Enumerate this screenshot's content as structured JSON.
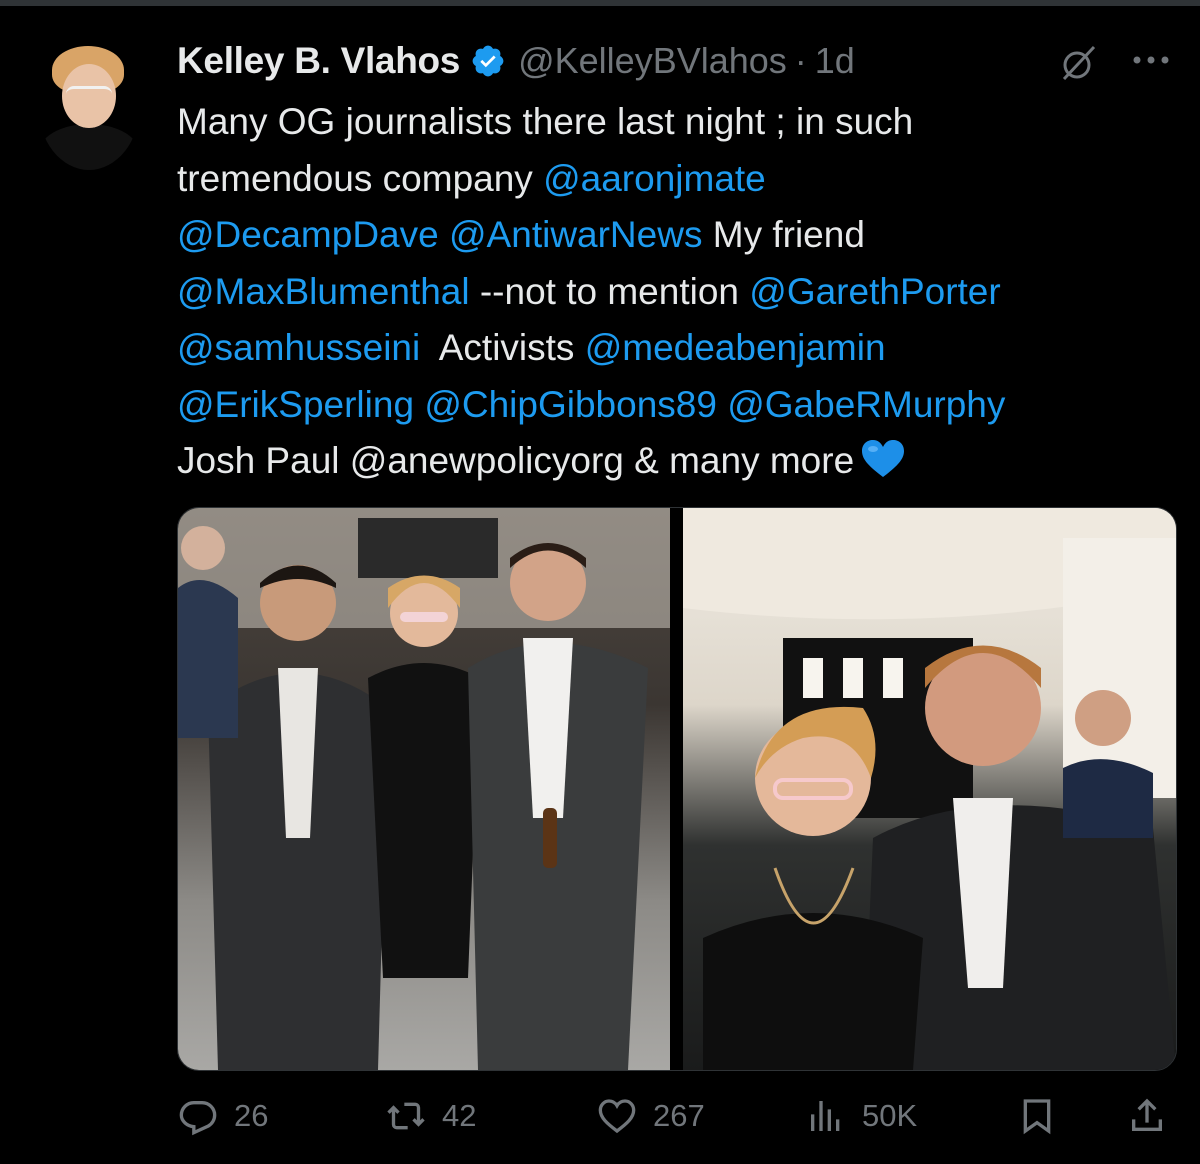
{
  "tweet": {
    "author": {
      "name": "Kelley B. Vlahos",
      "handle": "@KelleyBVlahos",
      "dot": "·",
      "time": "1d",
      "verified": true
    },
    "text": {
      "l1": "Many OG journalists there last night ; in such",
      "l2a": "tremendous company ",
      "m1": "@aaronjmate",
      "m2": "@DecampDave",
      "sp1": " ",
      "m3": "@AntiwarNews",
      "l3b": " My friend",
      "m4": "@MaxBlumenthal",
      "l4b": " --not to mention ",
      "m5": "@GarethPorter",
      "m6": "@samhusseini",
      "l5b": "  Activists ",
      "m7": "@medeabenjamin",
      "m8": "@ErikSperling",
      "sp2": " ",
      "m9": "@ChipGibbons89",
      "sp3": " ",
      "m10": "@GabeRMurphy",
      "l7": "Josh Paul @anewpolicyorg & many more"
    },
    "emoji": "blue-heart",
    "stats": {
      "replies": "26",
      "reposts": "42",
      "likes": "267",
      "views": "50K"
    }
  },
  "icons": {
    "verified": "verified-badge-icon",
    "grok": "grok-icon",
    "more": "more-icon",
    "reply": "reply-icon",
    "repost": "repost-icon",
    "like": "heart-icon",
    "views": "views-icon",
    "bookmark": "bookmark-icon",
    "share": "share-icon"
  },
  "colors": {
    "background": "#000000",
    "text": "#e7e9ea",
    "muted": "#71767b",
    "link": "#1d9bf0",
    "verified": "#1d9bf0"
  }
}
